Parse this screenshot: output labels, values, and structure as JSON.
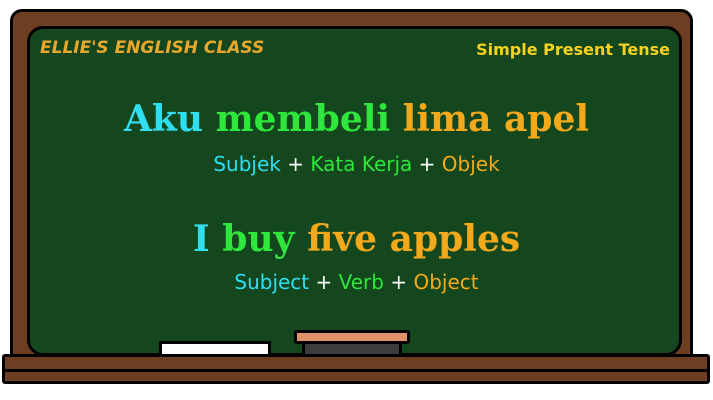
{
  "header": {
    "class_name": "ELLIE'S ENGLISH CLASS",
    "topic": "Simple Present Tense"
  },
  "indonesian": {
    "sentence": {
      "subject": "Aku",
      "verb": "membeli",
      "object": "lima apel"
    },
    "structure": {
      "subject": "Subjek",
      "verb": "Kata Kerja",
      "object": "Objek",
      "plus": "+"
    }
  },
  "english": {
    "sentence": {
      "subject": "I",
      "verb": "buy",
      "object": "five apples"
    },
    "structure": {
      "subject": "Subject",
      "verb": "Verb",
      "object": "Object",
      "plus": "+"
    }
  },
  "colors": {
    "subject": "#2fdff0",
    "verb": "#2ee63c",
    "object": "#f2a91b",
    "board": "#14471e",
    "frame": "#6e3e22"
  }
}
